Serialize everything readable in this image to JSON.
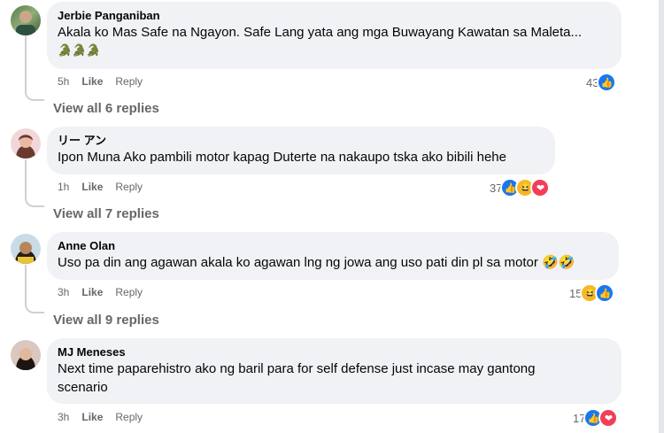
{
  "comments": [
    {
      "author": "Jerbie Panganiban",
      "text": "Akala ko Mas Safe na Ngayon. Safe Lang yata ang mga Buwayang Kawatan sa Maleta...",
      "emoji": "🐊🐊🐊",
      "time": "5h",
      "like_label": "Like",
      "reply_label": "Reply",
      "reaction_count": "43",
      "reactions": [
        "like"
      ],
      "view_replies": "View all 6 replies"
    },
    {
      "author": "リー アン",
      "text": "Ipon Muna Ako pambili motor kapag Duterte na nakaupo tska ako bibili hehe",
      "time": "1h",
      "like_label": "Like",
      "reply_label": "Reply",
      "reaction_count": "37",
      "reactions": [
        "like",
        "haha",
        "love"
      ],
      "view_replies": "View all 7 replies"
    },
    {
      "author": "Anne Olan",
      "text": "Uso pa din ang agawan akala ko agawan lng ng jowa ang uso pati din pl sa motor 🤣🤣",
      "time": "3h",
      "like_label": "Like",
      "reply_label": "Reply",
      "reaction_count": "15",
      "reactions": [
        "haha",
        "like"
      ],
      "view_replies": "View all 9 replies"
    },
    {
      "author": "MJ Meneses",
      "text_line1": "Next time paparehistro ako ng baril para for self defense just incase may gantong",
      "text_line2": "scenario",
      "time": "3h",
      "like_label": "Like",
      "reply_label": "Reply",
      "reaction_count": "17",
      "reactions": [
        "like",
        "love"
      ]
    }
  ],
  "colors": {
    "bubble": "#f0f2f5",
    "secondary_text": "#65676b",
    "like_blue": "#1877f2",
    "haha_yellow": "#f7b928",
    "love_red": "#f33e58"
  }
}
